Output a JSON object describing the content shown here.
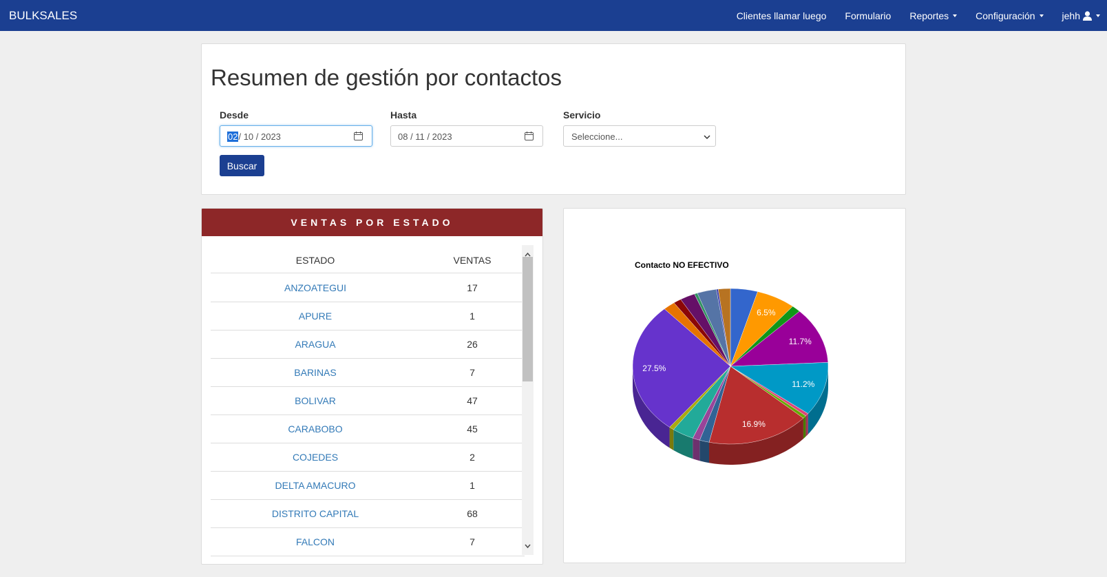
{
  "navbar": {
    "brand": "BULKSALES",
    "items": [
      {
        "label": "Clientes llamar luego",
        "dropdown": false
      },
      {
        "label": "Formulario",
        "dropdown": false
      },
      {
        "label": "Reportes",
        "dropdown": true
      },
      {
        "label": "Configuración",
        "dropdown": true
      }
    ],
    "user": "jehh",
    "user_icon": "user-icon"
  },
  "page": {
    "title": "Resumen de gestión por contactos"
  },
  "filters": {
    "desde_label": "Desde",
    "desde_day": "02",
    "desde_rest": "/ 10 / 2023",
    "hasta_label": "Hasta",
    "hasta_value": "08 / 11 / 2023",
    "servicio_label": "Servicio",
    "servicio_value": "Seleccione...",
    "buscar_label": "Buscar"
  },
  "ventas_panel": {
    "title": "VENTAS POR ESTADO",
    "columns": [
      "ESTADO",
      "VENTAS"
    ],
    "rows": [
      {
        "estado": "ANZOATEGUI",
        "ventas": "17"
      },
      {
        "estado": "APURE",
        "ventas": "1"
      },
      {
        "estado": "ARAGUA",
        "ventas": "26"
      },
      {
        "estado": "BARINAS",
        "ventas": "7"
      },
      {
        "estado": "BOLIVAR",
        "ventas": "47"
      },
      {
        "estado": "CARABOBO",
        "ventas": "45"
      },
      {
        "estado": "COJEDES",
        "ventas": "2"
      },
      {
        "estado": "DELTA AMACURO",
        "ventas": "1"
      },
      {
        "estado": "DISTRITO CAPITAL",
        "ventas": "68"
      },
      {
        "estado": "FALCON",
        "ventas": "7"
      }
    ]
  },
  "chart_data": {
    "type": "pie",
    "title": "Contacto NO EFECTIVO",
    "style": "3d",
    "slices": [
      {
        "value": 4.5,
        "color": "#3366cc",
        "label": ""
      },
      {
        "value": 6.5,
        "color": "#ff9900",
        "label": "6.5%"
      },
      {
        "value": 1.5,
        "color": "#109618",
        "label": ""
      },
      {
        "value": 11.7,
        "color": "#990099",
        "label": "11.7%"
      },
      {
        "value": 11.2,
        "color": "#0099c6",
        "label": "11.2%"
      },
      {
        "value": 0.6,
        "color": "#dd4477",
        "label": ""
      },
      {
        "value": 0.6,
        "color": "#66aa00",
        "label": ""
      },
      {
        "value": 16.9,
        "color": "#b82e2e",
        "label": "16.9%"
      },
      {
        "value": 1.6,
        "color": "#316395",
        "label": ""
      },
      {
        "value": 1.2,
        "color": "#994499",
        "label": ""
      },
      {
        "value": 3.6,
        "color": "#22aa99",
        "label": ""
      },
      {
        "value": 0.8,
        "color": "#aaaa11",
        "label": ""
      },
      {
        "value": 27.5,
        "color": "#6633cc",
        "label": "27.5%"
      },
      {
        "value": 2.0,
        "color": "#e67300",
        "label": ""
      },
      {
        "value": 1.3,
        "color": "#8b0707",
        "label": ""
      },
      {
        "value": 2.5,
        "color": "#651067",
        "label": ""
      },
      {
        "value": 0.5,
        "color": "#329262",
        "label": ""
      },
      {
        "value": 3.2,
        "color": "#5574a6",
        "label": ""
      },
      {
        "value": 0.3,
        "color": "#3b3eac",
        "label": ""
      },
      {
        "value": 2.0,
        "color": "#b77322",
        "label": ""
      }
    ]
  }
}
